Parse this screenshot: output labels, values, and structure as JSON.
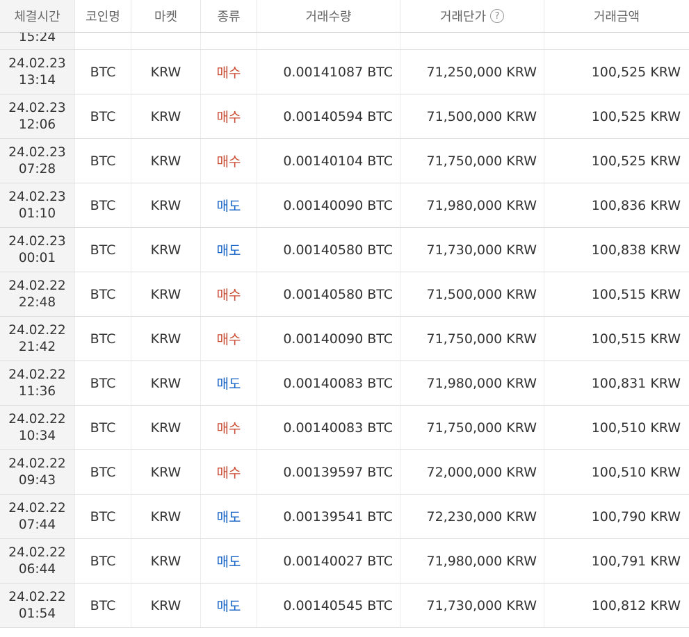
{
  "columns": [
    "체결시간",
    "코인명",
    "마켓",
    "종류",
    "거래수량",
    "거래단가",
    "거래금액"
  ],
  "partial_row": {
    "time": "15:24"
  },
  "colors": {
    "buy": "#c84a31",
    "sell": "#1261c4"
  },
  "rows": [
    {
      "date": "24.02.23",
      "time": "13:14",
      "coin": "BTC",
      "market": "KRW",
      "type": "매수",
      "side": "buy",
      "qty": "0.00141087 BTC",
      "price": "71,250,000 KRW",
      "amount": "100,525 KRW"
    },
    {
      "date": "24.02.23",
      "time": "12:06",
      "coin": "BTC",
      "market": "KRW",
      "type": "매수",
      "side": "buy",
      "qty": "0.00140594 BTC",
      "price": "71,500,000 KRW",
      "amount": "100,525 KRW"
    },
    {
      "date": "24.02.23",
      "time": "07:28",
      "coin": "BTC",
      "market": "KRW",
      "type": "매수",
      "side": "buy",
      "qty": "0.00140104 BTC",
      "price": "71,750,000 KRW",
      "amount": "100,525 KRW"
    },
    {
      "date": "24.02.23",
      "time": "01:10",
      "coin": "BTC",
      "market": "KRW",
      "type": "매도",
      "side": "sell",
      "qty": "0.00140090 BTC",
      "price": "71,980,000 KRW",
      "amount": "100,836 KRW"
    },
    {
      "date": "24.02.23",
      "time": "00:01",
      "coin": "BTC",
      "market": "KRW",
      "type": "매도",
      "side": "sell",
      "qty": "0.00140580 BTC",
      "price": "71,730,000 KRW",
      "amount": "100,838 KRW"
    },
    {
      "date": "24.02.22",
      "time": "22:48",
      "coin": "BTC",
      "market": "KRW",
      "type": "매수",
      "side": "buy",
      "qty": "0.00140580 BTC",
      "price": "71,500,000 KRW",
      "amount": "100,515 KRW"
    },
    {
      "date": "24.02.22",
      "time": "21:42",
      "coin": "BTC",
      "market": "KRW",
      "type": "매수",
      "side": "buy",
      "qty": "0.00140090 BTC",
      "price": "71,750,000 KRW",
      "amount": "100,515 KRW"
    },
    {
      "date": "24.02.22",
      "time": "11:36",
      "coin": "BTC",
      "market": "KRW",
      "type": "매도",
      "side": "sell",
      "qty": "0.00140083 BTC",
      "price": "71,980,000 KRW",
      "amount": "100,831 KRW"
    },
    {
      "date": "24.02.22",
      "time": "10:34",
      "coin": "BTC",
      "market": "KRW",
      "type": "매수",
      "side": "buy",
      "qty": "0.00140083 BTC",
      "price": "71,750,000 KRW",
      "amount": "100,510 KRW"
    },
    {
      "date": "24.02.22",
      "time": "09:43",
      "coin": "BTC",
      "market": "KRW",
      "type": "매수",
      "side": "buy",
      "qty": "0.00139597 BTC",
      "price": "72,000,000 KRW",
      "amount": "100,510 KRW"
    },
    {
      "date": "24.02.22",
      "time": "07:44",
      "coin": "BTC",
      "market": "KRW",
      "type": "매도",
      "side": "sell",
      "qty": "0.00139541 BTC",
      "price": "72,230,000 KRW",
      "amount": "100,790 KRW"
    },
    {
      "date": "24.02.22",
      "time": "06:44",
      "coin": "BTC",
      "market": "KRW",
      "type": "매도",
      "side": "sell",
      "qty": "0.00140027 BTC",
      "price": "71,980,000 KRW",
      "amount": "100,791 KRW"
    },
    {
      "date": "24.02.22",
      "time": "01:54",
      "coin": "BTC",
      "market": "KRW",
      "type": "매도",
      "side": "sell",
      "qty": "0.00140545 BTC",
      "price": "71,730,000 KRW",
      "amount": "100,812 KRW"
    }
  ]
}
